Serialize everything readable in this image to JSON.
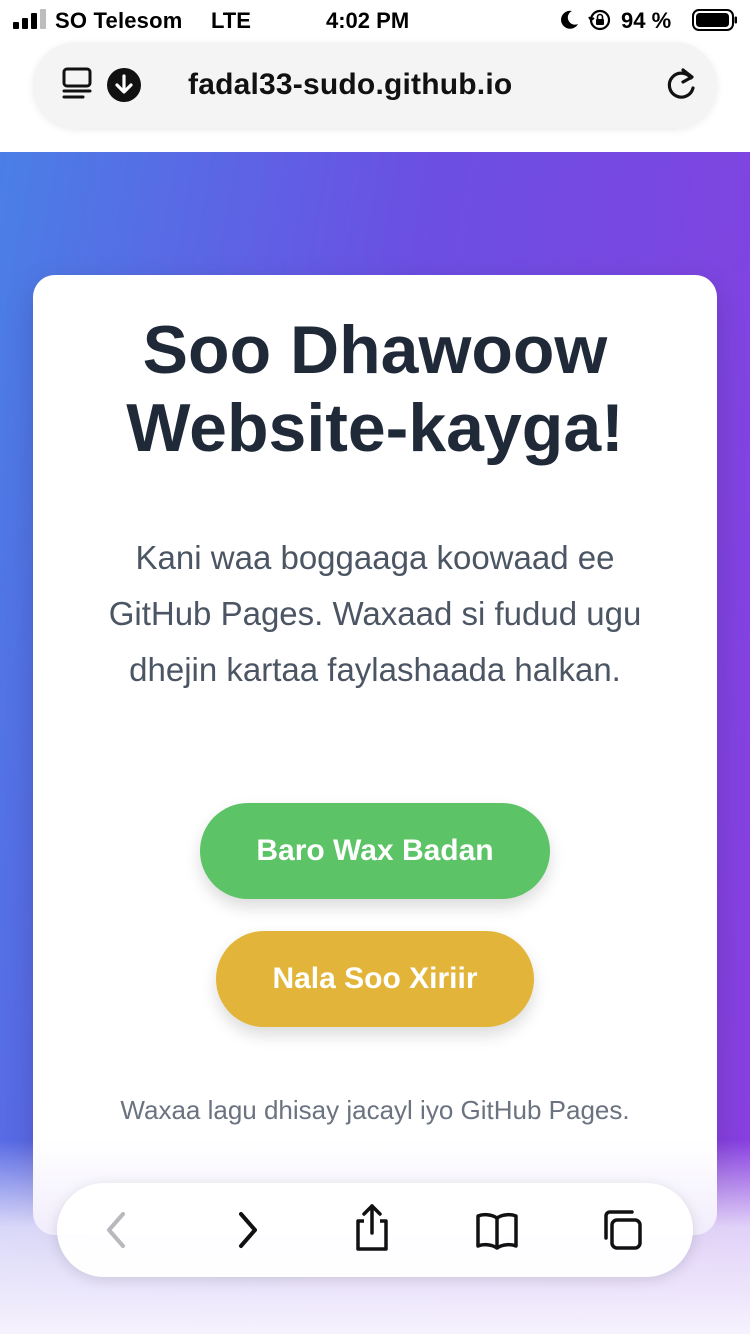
{
  "status_bar": {
    "carrier": "SO Telesom",
    "network": "LTE",
    "time": "4:02 PM",
    "battery_percent": "94 %",
    "icons": [
      "signal-icon",
      "moon-icon",
      "orientation-lock-icon",
      "battery-icon"
    ]
  },
  "address_bar": {
    "url": "fadal33-sudo.github.io",
    "icons": [
      "reader-icon",
      "download-icon",
      "reload-icon"
    ]
  },
  "page": {
    "headline": "Soo Dhawoow Website-kayga!",
    "intro": "Kani waa boggaaga koowaad ee GitHub Pages. Waxaad si fudud ugu dhejin kartaa faylashaada halkan.",
    "buttons": {
      "learn_more": "Baro Wax Badan",
      "contact": "Nala Soo Xiriir"
    },
    "footer": "Waxaa lagu dhisay jacayl iyo GitHub Pages.",
    "colors": {
      "gradient_start": "#4a7fe6",
      "gradient_end": "#8a3ee0",
      "learn_button": "#5cc467",
      "contact_button": "#e2b53a",
      "heading": "#1f2937"
    }
  },
  "toolbar": {
    "icons": [
      "back-icon",
      "forward-icon",
      "share-icon",
      "bookmarks-icon",
      "tabs-icon"
    ]
  }
}
